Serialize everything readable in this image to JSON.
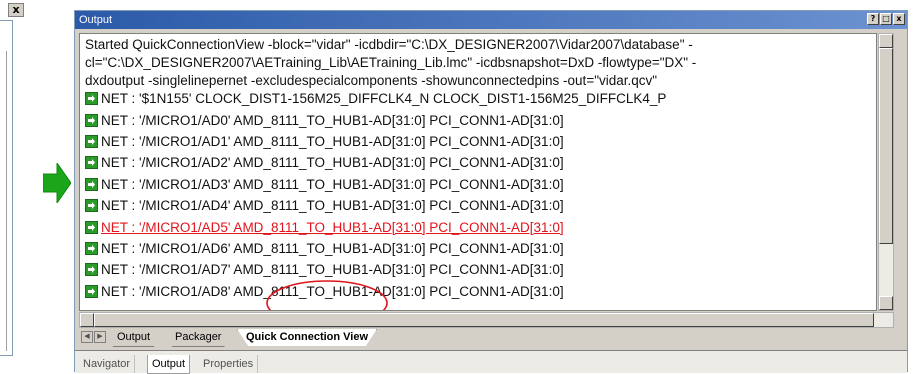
{
  "left_panel": {
    "close_label": "x"
  },
  "window": {
    "title": "Output",
    "title_buttons": [
      "?",
      "□",
      "x"
    ]
  },
  "output": {
    "command_lines": [
      "Started QuickConnectionView -block=\"vidar\" -icdbdir=\"C:\\DX_DESIGNER2007\\Vidar2007\\database\" -",
      "cl=\"C:\\DX_DESIGNER2007\\AETraining_Lib\\AETraining_Lib.lmc\" -icdbsnapshot=DxD -flowtype=\"DX\" -",
      "dxdoutput -singlelinepernet -excludespecialcomponents -showunconnectedpins -out=\"vidar.qcv\""
    ],
    "net_lines": [
      {
        "text": "NET : '$1N155' CLOCK_DIST1-156M25_DIFFCLK4_N CLOCK_DIST1-156M25_DIFFCLK4_P",
        "error": false
      },
      {
        "text": "NET : '/MICRO1/AD0' AMD_8111_TO_HUB1-AD[31:0] PCI_CONN1-AD[31:0]",
        "error": false
      },
      {
        "text": "NET : '/MICRO1/AD1' AMD_8111_TO_HUB1-AD[31:0] PCI_CONN1-AD[31:0]",
        "error": false
      },
      {
        "text": "NET : '/MICRO1/AD2' AMD_8111_TO_HUB1-AD[31:0] PCI_CONN1-AD[31:0]",
        "error": false
      },
      {
        "text": "NET : '/MICRO1/AD3' AMD_8111_TO_HUB1-AD[31:0] PCI_CONN1-AD[31:0]",
        "error": false
      },
      {
        "text": "NET : '/MICRO1/AD4' AMD_8111_TO_HUB1-AD[31:0] PCI_CONN1-AD[31:0]",
        "error": false
      },
      {
        "text": "NET : '/MICRO1/AD5' AMD_8111_TO_HUB1-AD[31:0] PCI_CONN1-AD[31:0]",
        "error": true
      },
      {
        "text": "NET : '/MICRO1/AD6' AMD_8111_TO_HUB1-AD[31:0] PCI_CONN1-AD[31:0]",
        "error": false
      },
      {
        "text": "NET : '/MICRO1/AD7' AMD_8111_TO_HUB1-AD[31:0] PCI_CONN1-AD[31:0]",
        "error": false
      },
      {
        "text": "NET : '/MICRO1/AD8' AMD_8111_TO_HUB1-AD[31:0] PCI_CONN1-AD[31:0]",
        "error": false
      }
    ],
    "net_icon": "green-arrow-icon",
    "error_color": "#e0141c"
  },
  "tabs": {
    "items": [
      "Output",
      "Packager",
      "Quick Connection View"
    ],
    "active": "Quick Connection View"
  },
  "bottom_tabs": {
    "items": [
      "Navigator",
      "Output",
      "Properties"
    ],
    "active": "Output"
  },
  "colors": {
    "title_bar": "#2b5aa8",
    "arrow_green": "#1aa51a",
    "annotation": "#e0141c"
  }
}
